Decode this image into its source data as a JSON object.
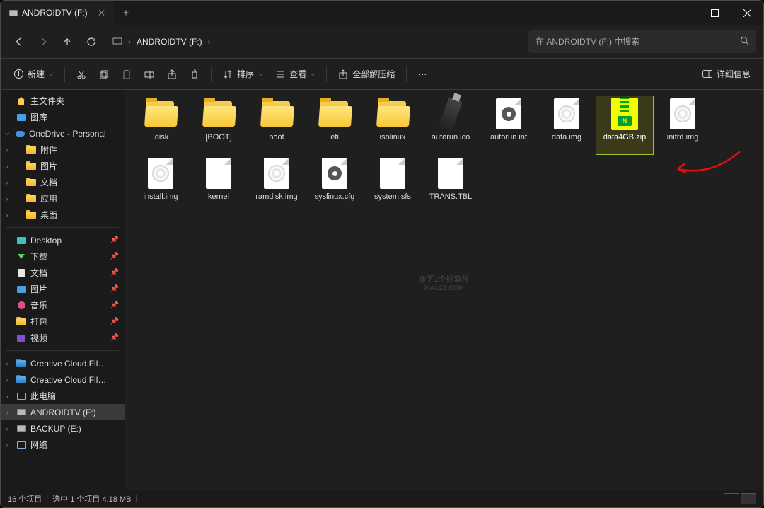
{
  "window": {
    "title": "ANDROIDTV (F:)"
  },
  "navbar": {
    "path_drive_label": "ANDROIDTV (F:)",
    "search_placeholder": "在 ANDROIDTV (F:) 中搜索"
  },
  "toolbar": {
    "new": "新建",
    "sort": "排序",
    "view": "查看",
    "extract_all": "全部解压缩",
    "details": "详细信息"
  },
  "sidebar": {
    "home": "主文件夹",
    "gallery": "图库",
    "onedrive": "OneDrive - Personal",
    "onedrive_items": [
      "附件",
      "图片",
      "文档",
      "应用",
      "桌面"
    ],
    "quick": [
      {
        "label": "Desktop"
      },
      {
        "label": "下载"
      },
      {
        "label": "文档"
      },
      {
        "label": "图片"
      },
      {
        "label": "音乐"
      },
      {
        "label": "打包"
      },
      {
        "label": "视频"
      }
    ],
    "bottom": [
      {
        "label": "Creative Cloud Files  dragon"
      },
      {
        "label": "Creative Cloud Files Persona"
      },
      {
        "label": "此电脑"
      },
      {
        "label": "ANDROIDTV (F:)",
        "selected": true
      },
      {
        "label": "BACKUP (E:)"
      },
      {
        "label": "网络"
      }
    ]
  },
  "files": [
    {
      "name": ".disk",
      "type": "folder"
    },
    {
      "name": "[BOOT]",
      "type": "folder"
    },
    {
      "name": "boot",
      "type": "folder"
    },
    {
      "name": "efi",
      "type": "folder"
    },
    {
      "name": "isolinux",
      "type": "folder"
    },
    {
      "name": "autorun.ico",
      "type": "usb"
    },
    {
      "name": "autorun.inf",
      "type": "gear"
    },
    {
      "name": "data.img",
      "type": "disc"
    },
    {
      "name": "data4GB.zip",
      "type": "zip",
      "highlight": true
    },
    {
      "name": "initrd.img",
      "type": "disc"
    },
    {
      "name": "install.img",
      "type": "disc"
    },
    {
      "name": "kernel",
      "type": "blank"
    },
    {
      "name": "ramdisk.img",
      "type": "disc"
    },
    {
      "name": "syslinux.cfg",
      "type": "gear"
    },
    {
      "name": "system.sfs",
      "type": "blank"
    },
    {
      "name": "TRANS.TBL",
      "type": "blank"
    }
  ],
  "status": {
    "count": "16 个项目",
    "selected": "选中 1 个项目  4.18 MB"
  },
  "watermark": {
    "l1": "@下1个好软件",
    "l2": "XIA1GE.COM"
  }
}
